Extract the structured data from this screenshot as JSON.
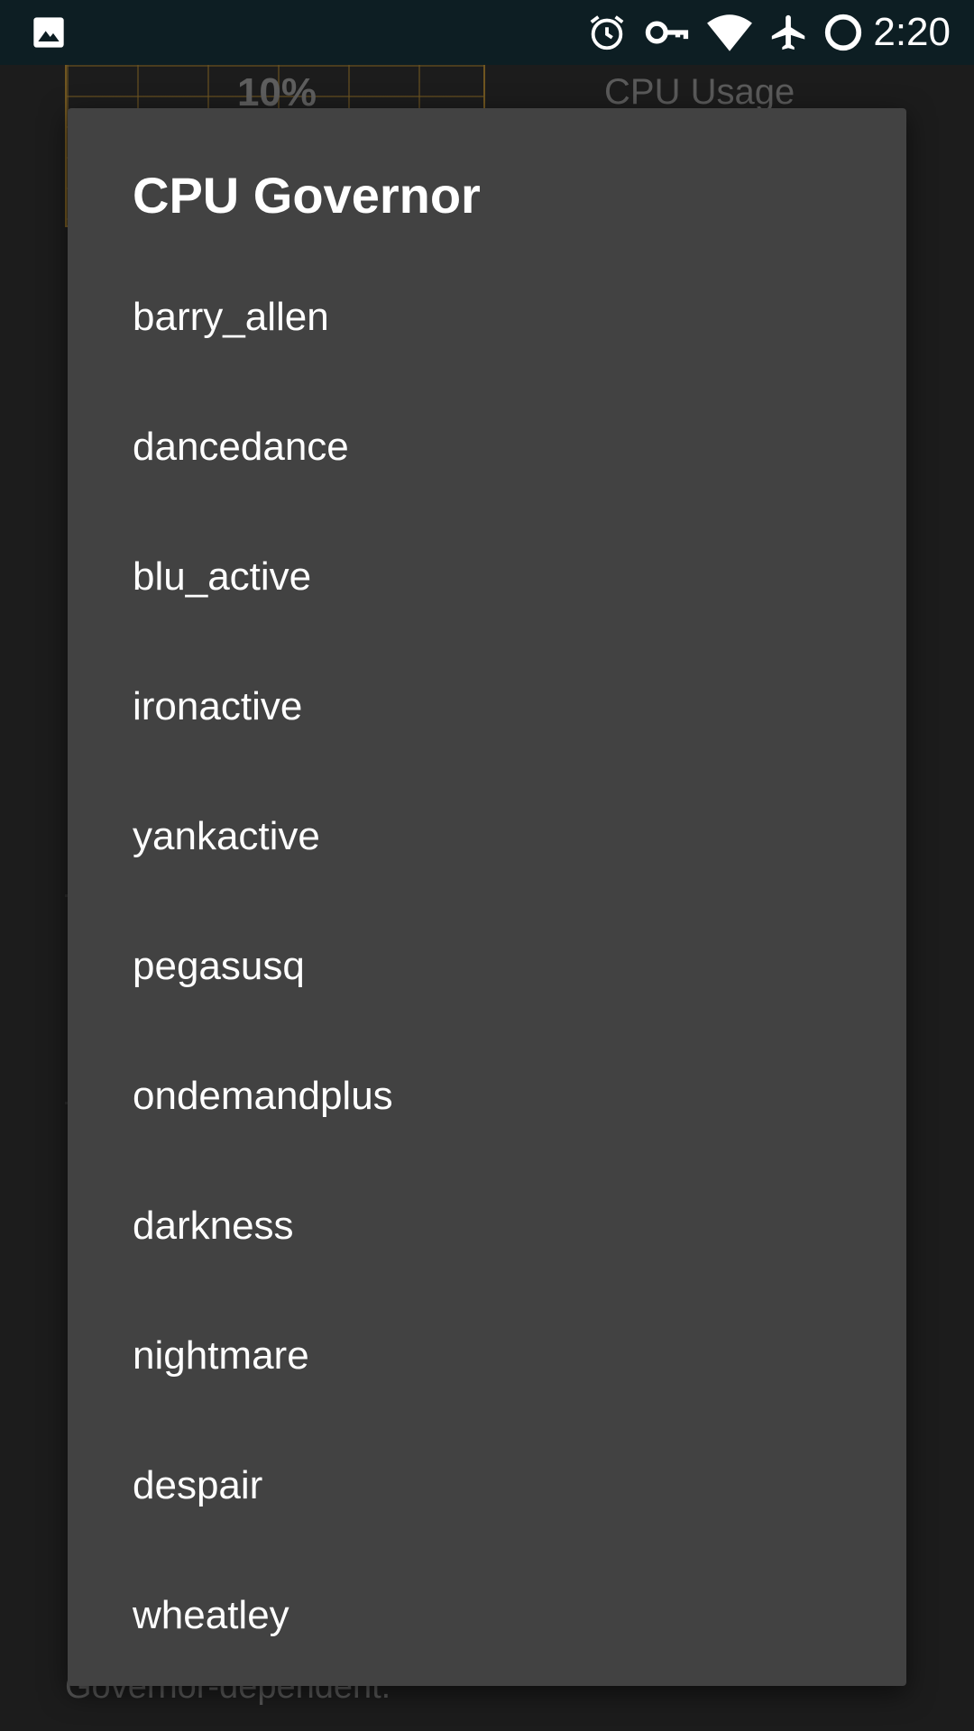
{
  "status_bar": {
    "time": "2:20",
    "icons": [
      "image-icon",
      "alarm-icon",
      "vpn-key-icon",
      "wifi-icon",
      "airplane-icon",
      "circle-icon"
    ]
  },
  "background": {
    "chart_value": "10%",
    "cpu_label": "CPU Usage",
    "bottom_text": "Governor-dependent."
  },
  "dialog": {
    "title": "CPU Governor",
    "options": [
      {
        "label": "barry_allen"
      },
      {
        "label": "dancedance"
      },
      {
        "label": "blu_active"
      },
      {
        "label": "ironactive"
      },
      {
        "label": "yankactive"
      },
      {
        "label": "pegasusq"
      },
      {
        "label": "ondemandplus"
      },
      {
        "label": "darkness"
      },
      {
        "label": "nightmare"
      },
      {
        "label": "despair"
      },
      {
        "label": "wheatley"
      }
    ]
  },
  "colors": {
    "status_bar_bg": "#0d1e23",
    "dialog_bg": "#424242",
    "screen_bg": "#1b1b1b",
    "chart_accent": "#6f5520"
  }
}
